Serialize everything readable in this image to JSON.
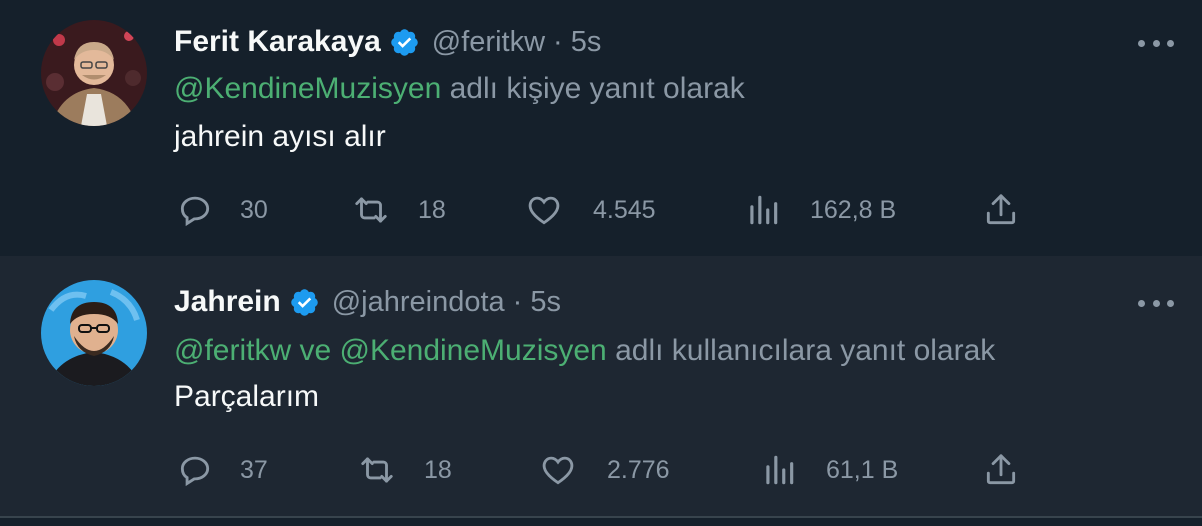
{
  "tweets": [
    {
      "name": "Ferit Karakaya",
      "handle": "@feritkw",
      "dot": "·",
      "time": "5s",
      "reply_mentions": "@KendineMuzisyen",
      "reply_suffix": "adlı kişiye yanıt olarak",
      "text": "jahrein ayısı alır",
      "replies": "30",
      "retweets": "18",
      "likes": "4.545",
      "views": "162,8 B"
    },
    {
      "name": "Jahrein",
      "handle": "@jahreindota",
      "dot": "·",
      "time": "5s",
      "reply_mentions": "@feritkw ve @KendineMuzisyen",
      "reply_suffix": "adlı kullanıcılara yanıt olarak",
      "text": "Parçalarım",
      "replies": "37",
      "retweets": "18",
      "likes": "2.776",
      "views": "61,1 B"
    }
  ],
  "colors": {
    "background": "#15202b",
    "highlight_background": "#1e2732",
    "mention": "#4caf73",
    "verified": "#1d9bf0",
    "muted": "#8b98a5"
  },
  "icons": [
    "verified-badge-icon",
    "more-icon",
    "reply-icon",
    "retweet-icon",
    "like-icon",
    "views-icon",
    "share-icon"
  ]
}
